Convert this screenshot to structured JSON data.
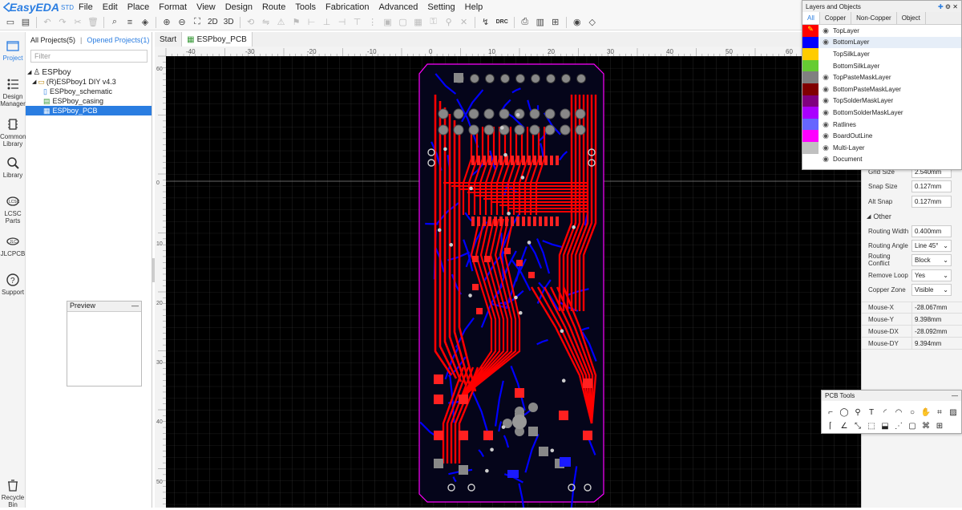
{
  "app": {
    "name": "EasyEDA",
    "edition": "STD"
  },
  "menu": [
    "File",
    "Edit",
    "Place",
    "Format",
    "View",
    "Design",
    "Route",
    "Tools",
    "Fabrication",
    "Advanced",
    "Setting",
    "Help"
  ],
  "toolbar": {
    "view2d": "2D",
    "view3d": "3D",
    "drc": "DRC"
  },
  "leftnav": [
    {
      "label": "Project",
      "icon": "folder-icon"
    },
    {
      "label": "Design Manager",
      "icon": "list-icon"
    },
    {
      "label": "Commonly Library",
      "icon": "chip-icon"
    },
    {
      "label": "Library",
      "icon": "search-library-icon"
    },
    {
      "label": "LCSC Parts",
      "icon": "lcsc-icon"
    },
    {
      "label": "JLCPCB",
      "icon": "jlcpcb-icon"
    },
    {
      "label": "Support",
      "icon": "support-icon"
    },
    {
      "label": "Recycle Bin",
      "icon": "trash-icon"
    }
  ],
  "projects": {
    "all_label": "All Projects(5)",
    "opened_label": "Opened Projects(1)",
    "filter_placeholder": "Filter",
    "owner": "ESPboy",
    "project": "(R)ESPboy1 DIY v4.3",
    "files": [
      "ESPboy_schematic",
      "ESPboy_casing",
      "ESPboy_PCB"
    ]
  },
  "preview": {
    "title": "Preview"
  },
  "doctabs": [
    "Start",
    "ESPboy_PCB"
  ],
  "ruler": {
    "labels": [
      "-40",
      "-30",
      "-20",
      "-10",
      "0",
      "10",
      "20",
      "30",
      "40",
      "50",
      "60"
    ],
    "vlabels": [
      "0",
      "10",
      "20",
      "30",
      "40",
      "50",
      "60"
    ]
  },
  "layers_panel": {
    "title": "Layers and Objects",
    "tabs": [
      "All",
      "Copper",
      "Non-Copper",
      "Object"
    ],
    "layers": [
      {
        "name": "TopLayer",
        "color": "#ff0000"
      },
      {
        "name": "BottomLayer",
        "color": "#0000ff"
      },
      {
        "name": "TopSilkLayer",
        "color": "#ffcc00"
      },
      {
        "name": "BottomSilkLayer",
        "color": "#66cc33"
      },
      {
        "name": "TopPasteMaskLayer",
        "color": "#808080"
      },
      {
        "name": "BottomPasteMaskLayer",
        "color": "#800000"
      },
      {
        "name": "TopSolderMaskLayer",
        "color": "#800080"
      },
      {
        "name": "BottomSolderMaskLayer",
        "color": "#aa00ff"
      },
      {
        "name": "Ratlines",
        "color": "#6666ff"
      },
      {
        "name": "BoardOutLine",
        "color": "#ff00ff"
      },
      {
        "name": "Multi-Layer",
        "color": "#c0c0c0"
      },
      {
        "name": "Document",
        "color": "#ffffff"
      }
    ]
  },
  "properties": {
    "grid_size_label": "Grid Size",
    "grid_size": "2.540mm",
    "snap_size_label": "Snap Size",
    "snap_size": "0.127mm",
    "alt_snap_label": "Alt Snap",
    "alt_snap": "0.127mm",
    "other_label": "Other",
    "routing_width_label": "Routing Width",
    "routing_width": "0.400mm",
    "routing_angle_label": "Routing Angle",
    "routing_angle": "Line 45°",
    "routing_conflict_label": "Routing Conflict",
    "routing_conflict": "Block",
    "remove_loop_label": "Remove Loop",
    "remove_loop": "Yes",
    "copper_zone_label": "Copper Zone",
    "copper_zone": "Visible"
  },
  "mouse": [
    {
      "label": "Mouse-X",
      "value": "-28.067mm"
    },
    {
      "label": "Mouse-Y",
      "value": "9.398mm"
    },
    {
      "label": "Mouse-DX",
      "value": "-28.092mm"
    },
    {
      "label": "Mouse-DY",
      "value": "9.394mm"
    }
  ],
  "pcb_tools": {
    "title": "PCB Tools"
  },
  "colors": {
    "accent": "#2a7de1",
    "canvas": "#000000",
    "top_copper": "#ff0000",
    "bottom_copper": "#0000ff",
    "outline": "#ff00ff"
  }
}
